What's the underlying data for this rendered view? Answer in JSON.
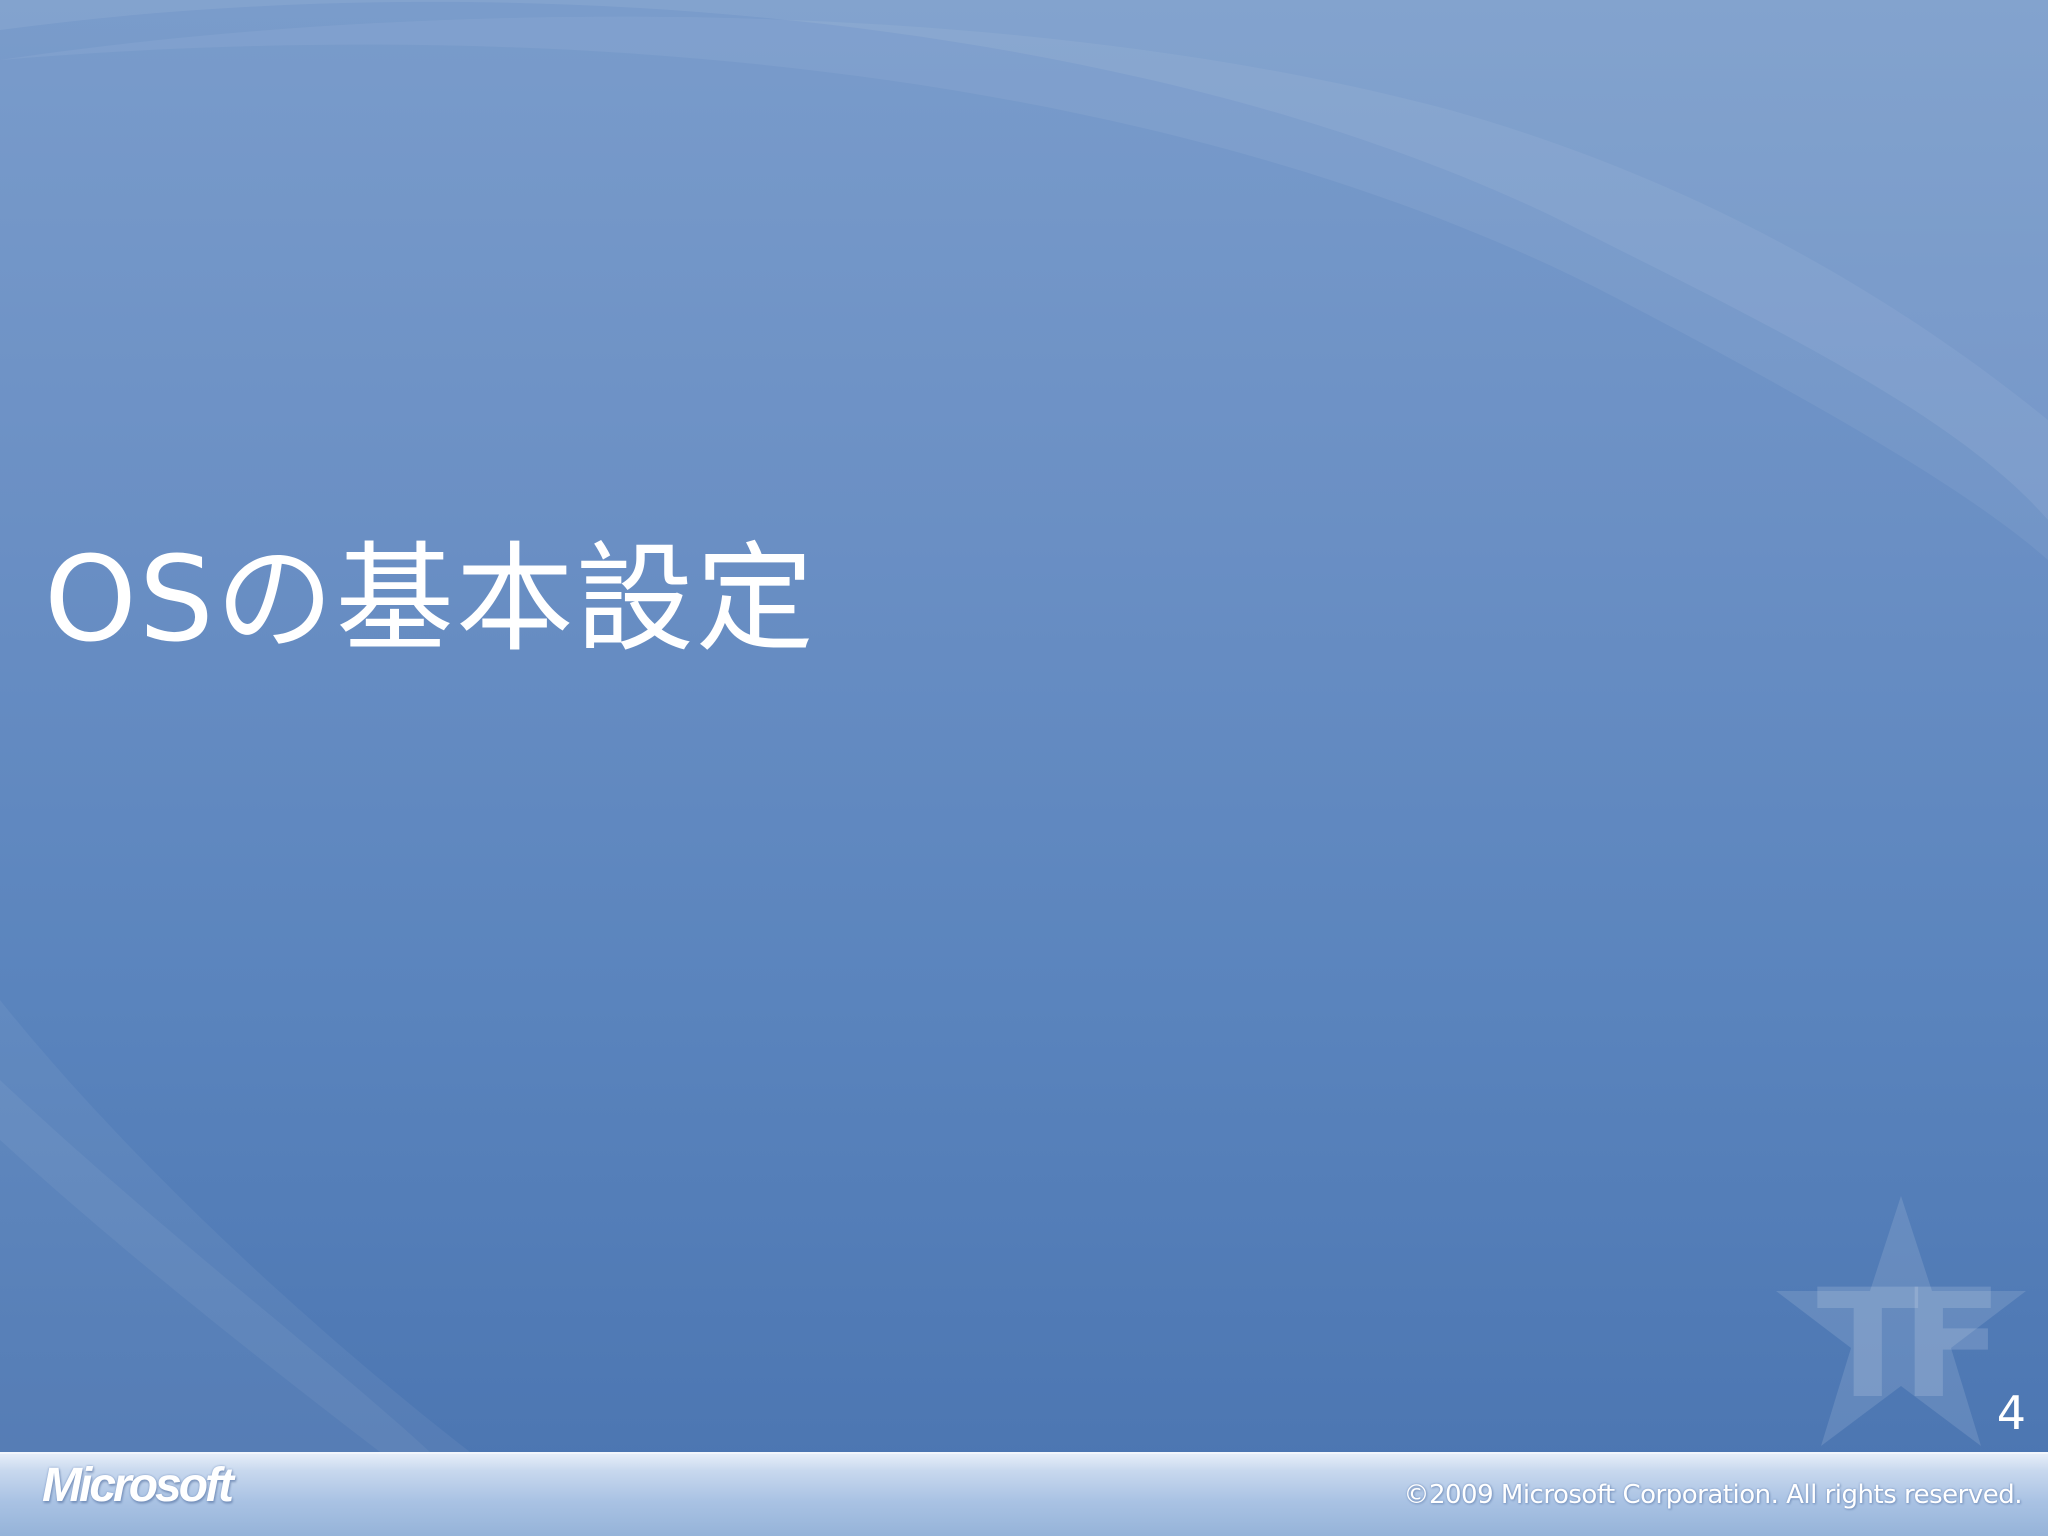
{
  "slide": {
    "title": "OSの基本設定",
    "page_number": "4"
  },
  "footer": {
    "logo_text": "Microsoft",
    "copyright": "©2009 Microsoft Corporation. All rights reserved."
  },
  "colors": {
    "background_top": "#7a9ccb",
    "background_bottom": "#4a74b0",
    "title_text": "#ffffff",
    "footer_bar": "#aac3e4"
  }
}
